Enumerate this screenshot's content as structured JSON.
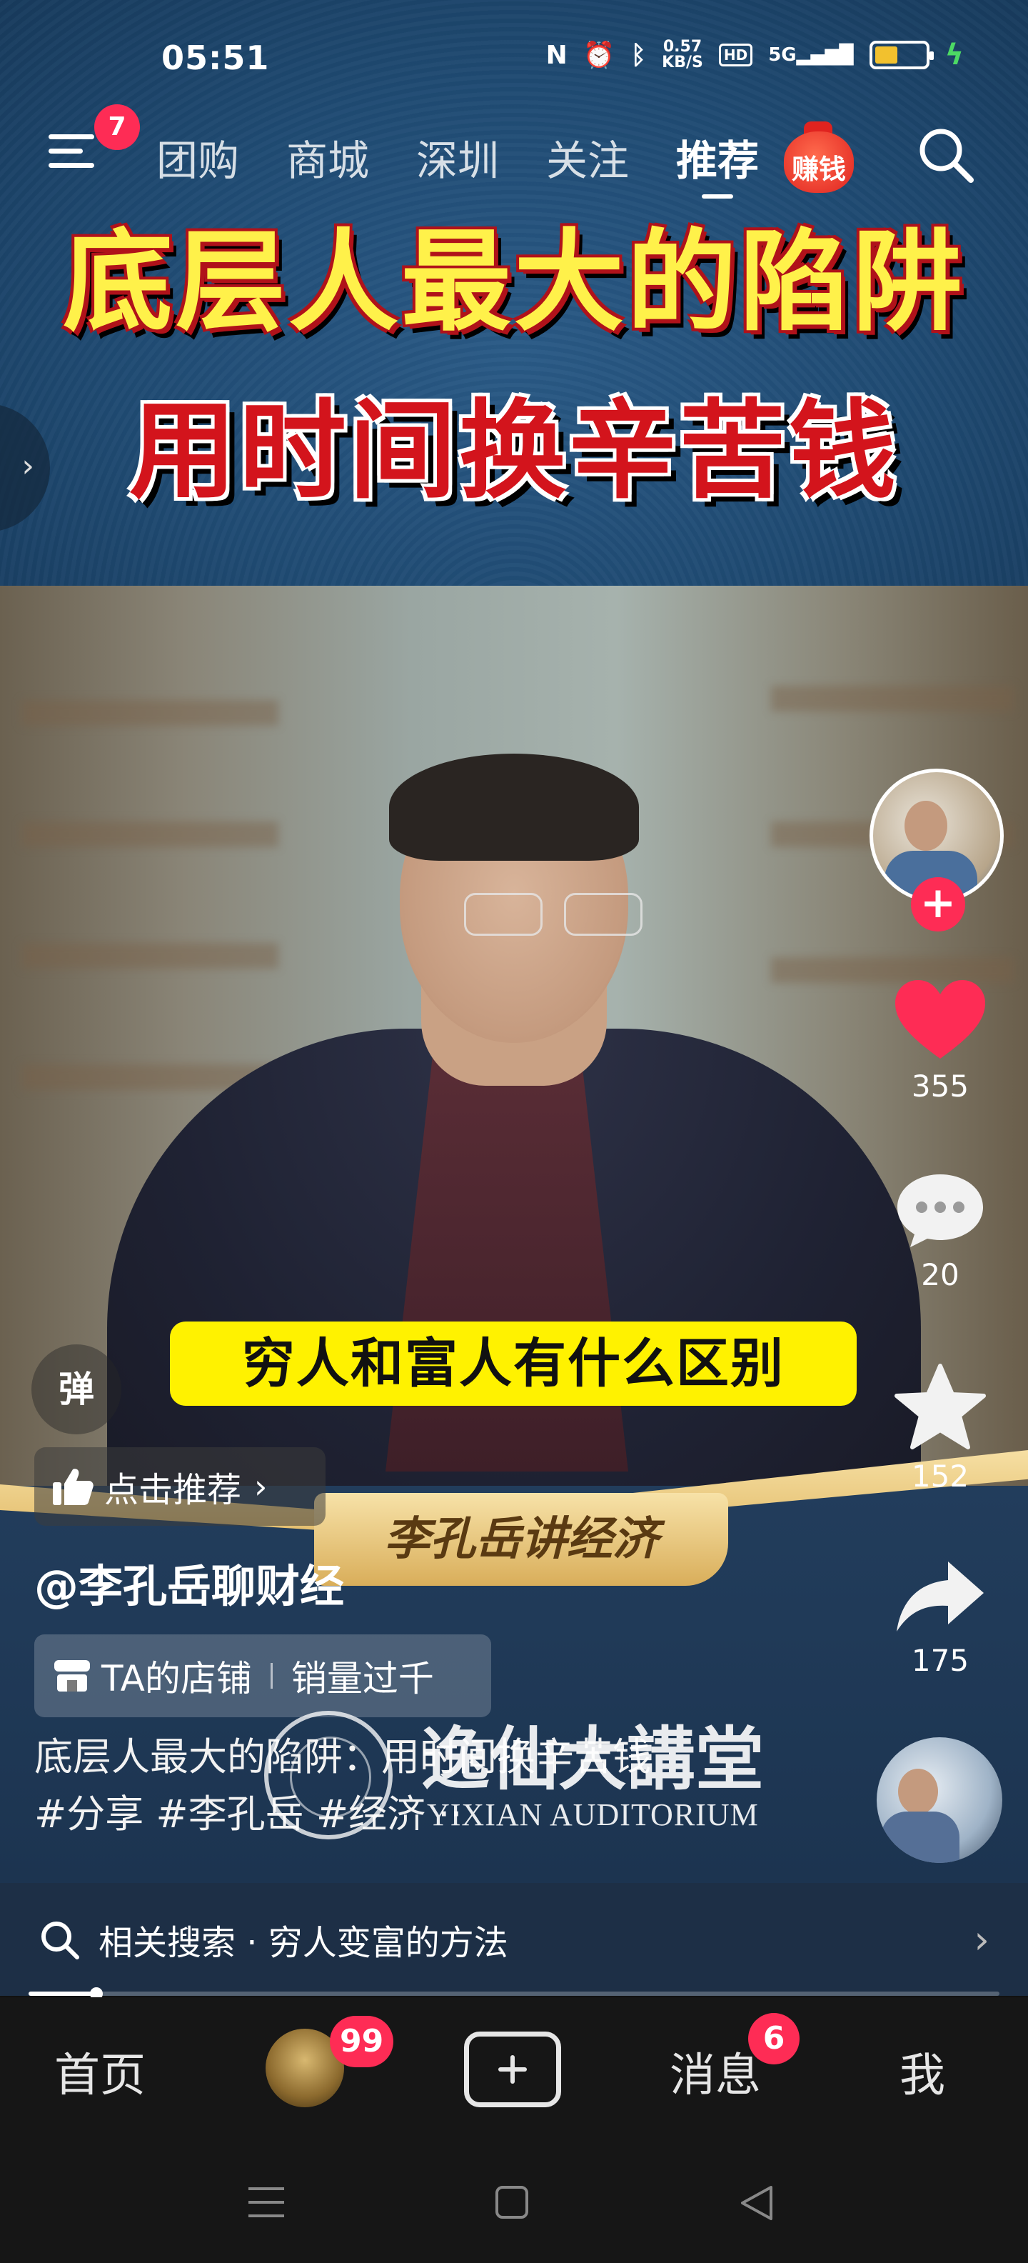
{
  "status_bar": {
    "time": "05:51",
    "net_speed_value": "0.57",
    "net_speed_unit": "KB/S",
    "hd_label": "HD",
    "network_label": "5G",
    "battery_level": 0.45
  },
  "top_nav": {
    "menu_badge": "7",
    "tabs": [
      "团购",
      "商城",
      "深圳",
      "关注",
      "推荐"
    ],
    "active_tab": "推荐",
    "earn_label": "赚钱"
  },
  "banner": {
    "title_line1": "底层人最大的陷阱",
    "title_line2": "用时间换辛苦钱"
  },
  "video": {
    "subtitle": "穷人和富人有什么区别",
    "danmu_label": "弹",
    "channel_plate": "李孔岳讲经济",
    "watermark_cn": "逸仙大講堂",
    "watermark_en": "YIXIAN AUDITORIUM"
  },
  "actions": {
    "likes": "355",
    "comments": "20",
    "favorites": "152",
    "shares": "175"
  },
  "info": {
    "recommend_label": "点击推荐",
    "author": "@李孔岳聊财经",
    "shop_label": "TA的店铺",
    "shop_sales": "销量过千",
    "description_line1": "底层人最大的陷阱：用时间换辛苦钱",
    "description_line2": "#分享 #李孔岳 #经济 ··"
  },
  "related_search": {
    "label": "相关搜索 · 穷人变富的方法"
  },
  "playback": {
    "progress": 0.07
  },
  "bottom_nav": {
    "home": "首页",
    "friends_badge": "99",
    "messages": "消息",
    "messages_badge": "6",
    "me": "我"
  },
  "colors": {
    "accent": "#fe2c55",
    "title_yellow": "#fff14a",
    "title_red": "#d3141c",
    "subtitle_yellow": "#fff200"
  }
}
